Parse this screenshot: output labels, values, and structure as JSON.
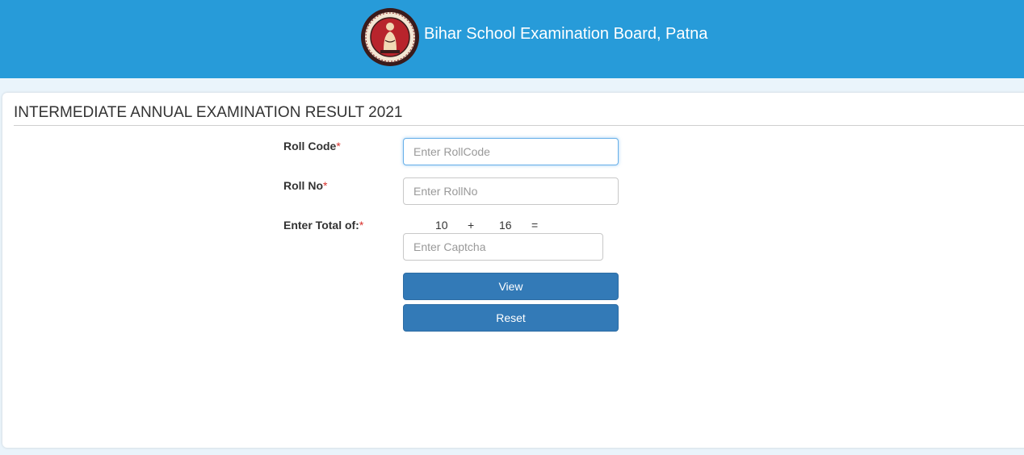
{
  "header": {
    "title": "Bihar School Examination Board, Patna",
    "logo_icon": "bseb-emblem-logo",
    "background_color": "#279bd9"
  },
  "panel": {
    "title": "INTERMEDIATE ANNUAL EXAMINATION RESULT 2021"
  },
  "form": {
    "roll_code": {
      "label": "Roll Code",
      "required_mark": "*",
      "value": "",
      "placeholder": "Enter RollCode"
    },
    "roll_no": {
      "label": "Roll No",
      "required_mark": "*",
      "value": "",
      "placeholder": "Enter RollNo"
    },
    "captcha": {
      "label": "Enter Total of:",
      "required_mark": "*",
      "operand1": "10",
      "operator": "+",
      "operand2": "16",
      "equals": "=",
      "value": "",
      "placeholder": "Enter Captcha"
    },
    "view_button": "View",
    "reset_button": "Reset"
  },
  "colors": {
    "button_primary": "#337ab7",
    "required_star": "#d9302c"
  }
}
